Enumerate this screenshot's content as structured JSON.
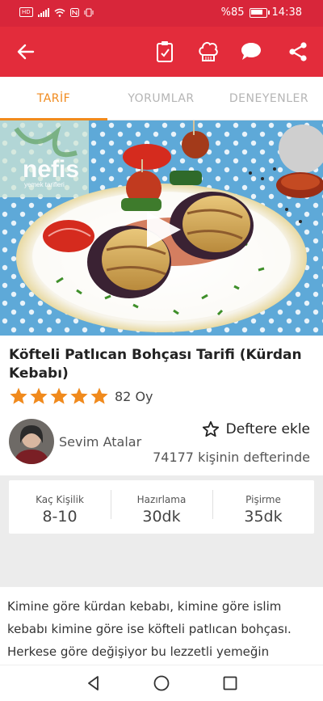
{
  "status_bar": {
    "left_chip": "HD",
    "battery_text": "%85",
    "battery_level": 0.85,
    "time": "14:38"
  },
  "app_bar": {
    "icons": [
      "back-arrow-icon",
      "notebook-check-icon",
      "chef-hat-icon",
      "chat-bubble-icon",
      "share-icon"
    ]
  },
  "tabs": [
    {
      "label": "TARİF",
      "active": true
    },
    {
      "label": "YORUMLAR",
      "active": false
    },
    {
      "label": "DENEYENLER",
      "active": false
    }
  ],
  "hero": {
    "watermark_logo": "nefis",
    "watermark_sub": "yemek tarifleri"
  },
  "recipe": {
    "title": "Köfteli Patlıcan Bohçası Tarifi (Kürdan Kebabı)",
    "rating": 5,
    "votes": "82 Oy"
  },
  "author": {
    "name": "Sevim Atalar"
  },
  "notebook": {
    "add_label": "Deftere ekle",
    "count_text": "74177 kişinin defterinde"
  },
  "info": [
    {
      "label": "Kaç Kişilik",
      "value": "8-10"
    },
    {
      "label": "Hazırlama",
      "value": "30dk"
    },
    {
      "label": "Pişirme",
      "value": "35dk"
    }
  ],
  "description": "Kimine göre kürdan kebabı, kimine göre islim kebabı kimine göre ise köfteli patlıcan bohçası. Herkese göre değişiyor bu lezzetli yemeğin",
  "colors": {
    "brand_red": "#e32c3b",
    "status_red": "#d8263a",
    "accent_orange": "#f08a1d",
    "star_orange": "#f08a1d"
  }
}
